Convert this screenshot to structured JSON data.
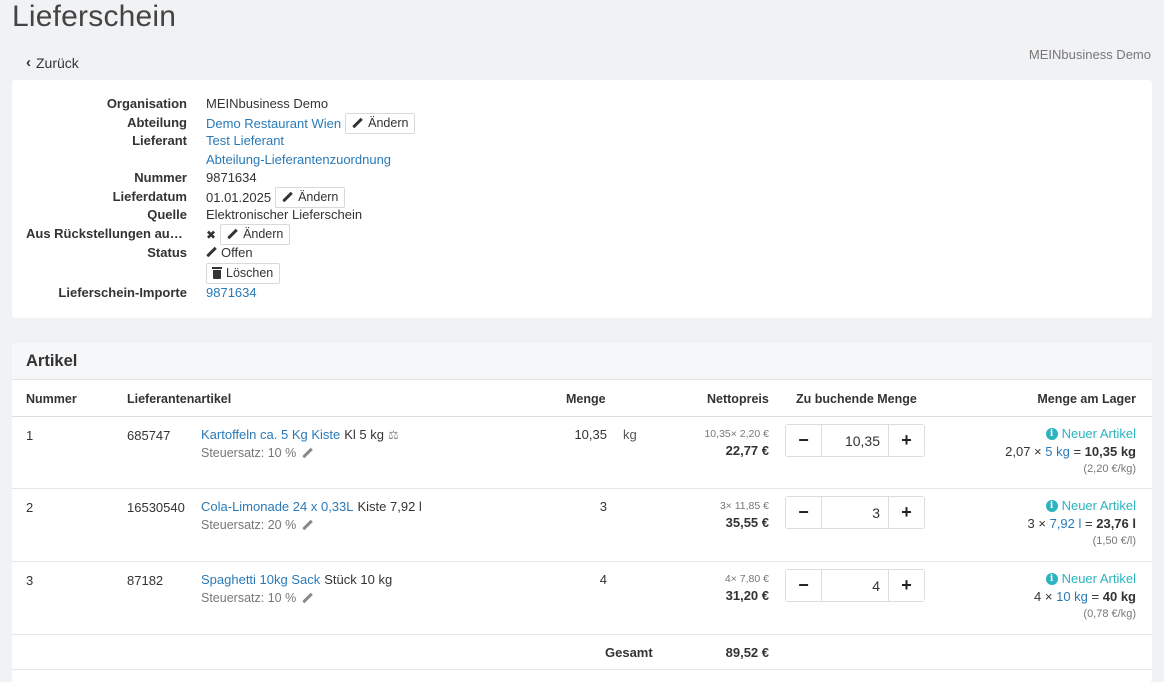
{
  "page_title": "Lieferschein",
  "back_label": "Zurück",
  "top_org": "MEINbusiness Demo",
  "info": {
    "organisation_label": "Organisation",
    "organisation_value": "MEINbusiness Demo",
    "abteilung_label": "Abteilung",
    "abteilung_value": "Demo Restaurant Wien",
    "abteilung_change": "Ändern",
    "lieferant_label": "Lieferant",
    "lieferant_value": "Test Lieferant",
    "lieferant_zuordnung": "Abteilung-Lieferantenzuordnung",
    "nummer_label": "Nummer",
    "nummer_value": "9871634",
    "lieferdatum_label": "Lieferdatum",
    "lieferdatum_value": "01.01.2025",
    "lieferdatum_change": "Ändern",
    "quelle_label": "Quelle",
    "quelle_value": "Elektronischer Lieferschein",
    "rueck_label": "Aus Rückstellungen ausnehmen",
    "rueck_icon": "✖",
    "rueck_change": "Ändern",
    "status_label": "Status",
    "status_value": "Offen",
    "delete_label": "Löschen",
    "importe_label": "Lieferschein-Importe",
    "importe_value": "9871634"
  },
  "artikel": {
    "title": "Artikel",
    "columns": {
      "nummer": "Nummer",
      "lieferantenartikel": "Lieferantenartikel",
      "menge": "Menge",
      "nettopreis": "Nettopreis",
      "zu_buchen": "Zu buchende Menge",
      "lager": "Menge am Lager"
    },
    "rows": [
      {
        "nr": "1",
        "code": "685747",
        "name": "Kartoffeln ca. 5 Kg Kiste",
        "pack": "Kl 5 kg",
        "has_scale": true,
        "steuer": "Steuersatz: 10 %",
        "menge": "10,35",
        "unit": "kg",
        "calc": "10,35× 2,20 €",
        "total": "22,77 €",
        "stepper_value": "10,35",
        "neu": "Neuer Artikel",
        "lager_qty": "2,07",
        "lager_unit": "5 kg",
        "lager_total": "10,35 kg",
        "lager_price": "(2,20 €/kg)"
      },
      {
        "nr": "2",
        "code": "16530540",
        "name": "Cola-Limonade 24 x 0,33L",
        "pack": "Kiste 7,92 l",
        "has_scale": false,
        "steuer": "Steuersatz: 20 %",
        "menge": "3",
        "unit": "",
        "calc": "3× 11,85 €",
        "total": "35,55 €",
        "stepper_value": "3",
        "neu": "Neuer Artikel",
        "lager_qty": "3",
        "lager_unit": "7,92 l",
        "lager_total": "23,76 l",
        "lager_price": "(1,50 €/l)"
      },
      {
        "nr": "3",
        "code": "87182",
        "name": "Spaghetti 10kg Sack",
        "pack": "Stück 10 kg",
        "has_scale": false,
        "steuer": "Steuersatz: 10 %",
        "menge": "4",
        "unit": "",
        "calc": "4× 7,80 €",
        "total": "31,20 €",
        "stepper_value": "4",
        "neu": "Neuer Artikel",
        "lager_qty": "4",
        "lager_unit": "10 kg",
        "lager_total": "40 kg",
        "lager_price": "(0,78 €/kg)"
      }
    ],
    "sum_label": "Gesamt",
    "sum_value": "89,52 €"
  },
  "colors": {
    "link": "#2a7ab7",
    "accent_info": "#2bb3c0",
    "background": "#f1f2f4"
  },
  "icons": {
    "back": "chevron-left-icon",
    "edit": "pencil-icon",
    "delete": "trash-icon",
    "scale": "scale-icon",
    "info": "info-circle-icon",
    "minus": "minus-icon",
    "plus": "plus-icon"
  }
}
